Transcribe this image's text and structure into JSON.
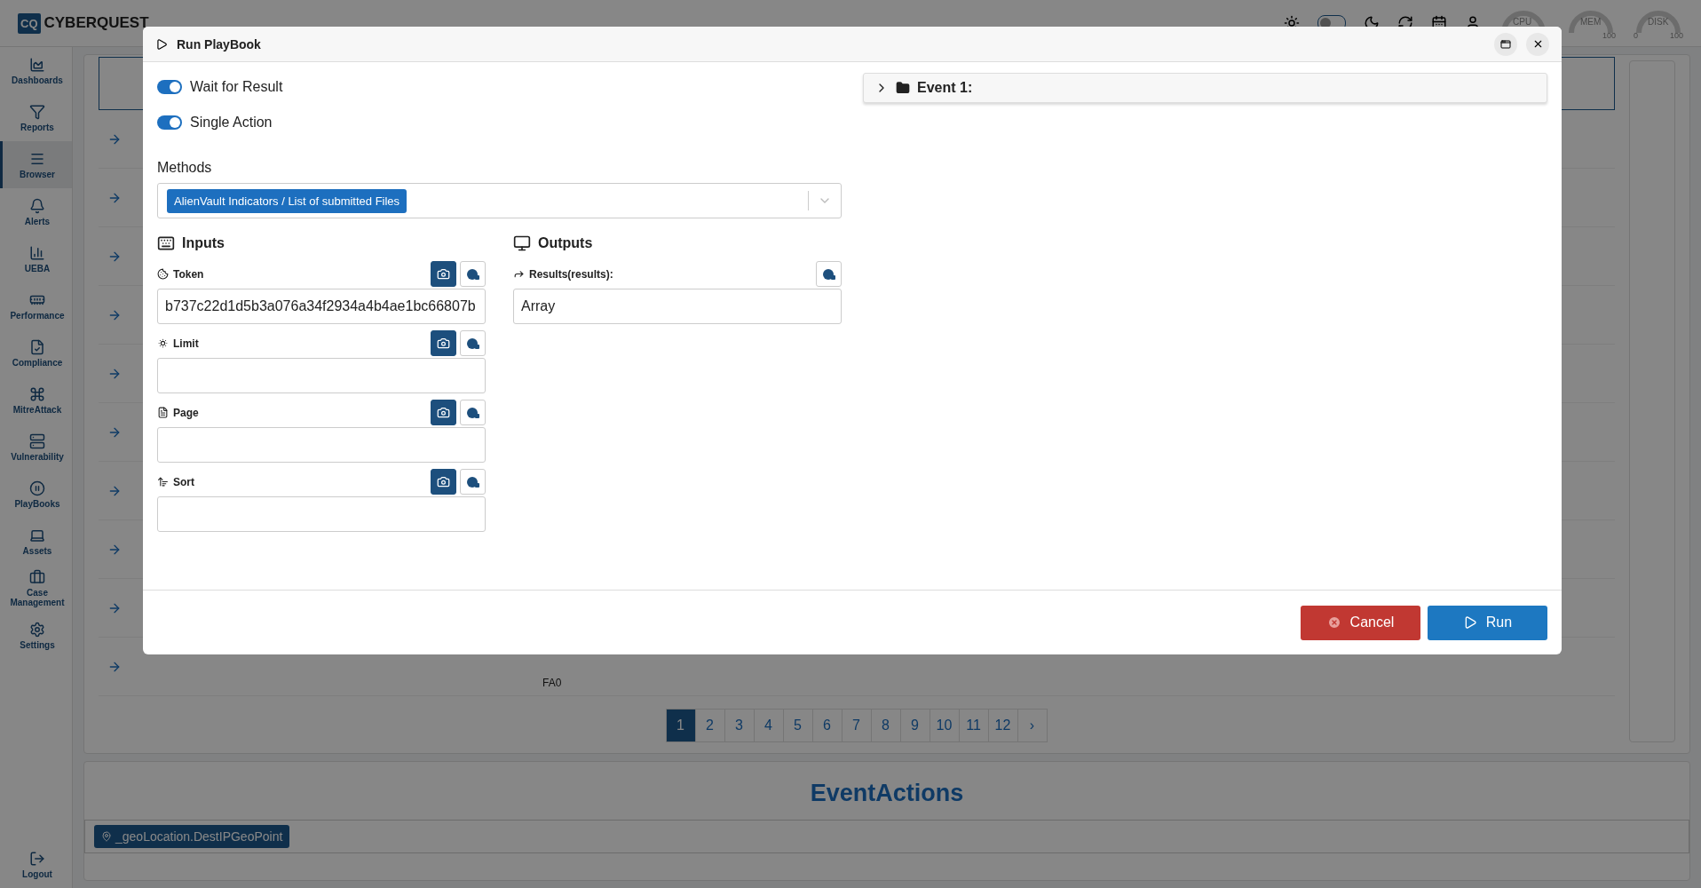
{
  "top_bar": {
    "logo_mark": "CQ",
    "logo_text": "CYBERQUEST",
    "dark_mode": {
      "on": false
    },
    "gauges": [
      {
        "label": "CPU"
      },
      {
        "label": "MEM",
        "max": "100"
      },
      {
        "label": "DISK",
        "min": "0",
        "max": "100"
      }
    ]
  },
  "sidebar": {
    "items": [
      {
        "label": "Dashboards",
        "selected": false
      },
      {
        "label": "Reports",
        "selected": false
      },
      {
        "label": "Browser",
        "selected": true
      },
      {
        "label": "Alerts",
        "selected": false
      },
      {
        "label": "UEBA",
        "selected": false
      },
      {
        "label": "Performance",
        "selected": false
      },
      {
        "label": "Compliance",
        "selected": false
      },
      {
        "label": "MitreAttack",
        "selected": false
      },
      {
        "label": "Vulnerability",
        "selected": false
      },
      {
        "label": "PlayBooks",
        "selected": false
      },
      {
        "label": "Assets",
        "selected": false
      },
      {
        "label": "Case Management",
        "selected": false
      },
      {
        "label": "Settings",
        "selected": false
      }
    ],
    "logout": "Logout"
  },
  "table": {
    "rows": [
      {
        "expanded": false
      },
      {
        "expanded": false
      },
      {
        "expanded": false
      },
      {
        "expanded": false
      },
      {
        "expanded": false
      },
      {
        "expanded": false
      },
      {
        "expanded": false
      },
      {
        "expanded": false
      },
      {
        "expanded": false
      },
      {
        "expanded": false,
        "cell": "FA0"
      }
    ]
  },
  "pagination": {
    "pages": [
      {
        "label": "1",
        "selected": true
      },
      {
        "label": "2",
        "selected": false
      },
      {
        "label": "3",
        "selected": false
      },
      {
        "label": "4",
        "selected": false
      },
      {
        "label": "5",
        "selected": false
      },
      {
        "label": "6",
        "selected": false
      },
      {
        "label": "7",
        "selected": false
      },
      {
        "label": "8",
        "selected": false
      },
      {
        "label": "9",
        "selected": false
      },
      {
        "label": "10",
        "selected": false
      },
      {
        "label": "11",
        "selected": false
      },
      {
        "label": "12",
        "selected": false
      }
    ],
    "next": "›"
  },
  "event_actions": {
    "title": "EventActions",
    "chip": "_geoLocation.DestIPGeoPoint"
  },
  "dialog": {
    "title": "Run PlayBook",
    "toggles": [
      {
        "label": "Wait for Result",
        "on": true
      },
      {
        "label": "Single Action",
        "on": true
      }
    ],
    "methods": {
      "label": "Methods",
      "selected": "AlienVault Indicators / List of submitted Files"
    },
    "inputs": {
      "title": "Inputs",
      "fields": [
        {
          "label": "Token",
          "value": "b737c22d1d5b3a076a34f2934a4b4ae1bc66807b"
        },
        {
          "label": "Limit"
        },
        {
          "label": "Page"
        },
        {
          "label": "Sort"
        }
      ]
    },
    "outputs": {
      "title": "Outputs",
      "fields": [
        {
          "label": "Results(results):",
          "value": "Array"
        }
      ]
    },
    "event": {
      "label": "Event 1:",
      "expanded": false
    },
    "buttons": {
      "cancel": "Cancel",
      "run": "Run"
    }
  }
}
